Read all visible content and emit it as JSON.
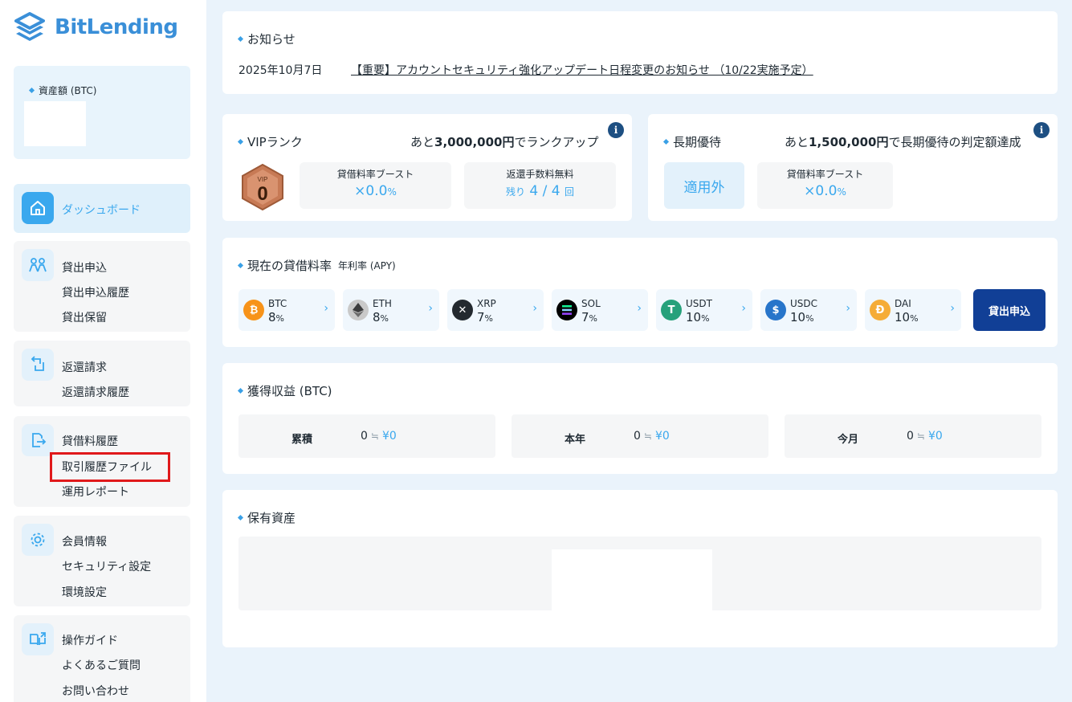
{
  "brand": {
    "name_part1": "Bit",
    "name_part2": "Lending"
  },
  "sidebar": {
    "asset_label": "資産額 (BTC)",
    "groups": [
      {
        "items": [
          "ダッシュボード"
        ]
      },
      {
        "items": [
          "貸出申込",
          "貸出申込履歴",
          "貸出保留"
        ]
      },
      {
        "items": [
          "返還請求",
          "返還請求履歴"
        ]
      },
      {
        "items": [
          "貸借料履歴",
          "取引履歴ファイル",
          "運用レポート"
        ]
      },
      {
        "items": [
          "会員情報",
          "セキュリティ設定",
          "環境設定"
        ]
      },
      {
        "items": [
          "操作ガイド",
          "よくあるご質問",
          "お問い合わせ"
        ]
      }
    ]
  },
  "news": {
    "title": "お知らせ",
    "date": "2025年10月7日",
    "headline": "【重要】アカウントセキュリティ強化アップデート日程変更のお知らせ （10/22実施予定）"
  },
  "vip": {
    "title": "VIPランク",
    "prefix": "あと",
    "amount": "3,000,000円",
    "suffix": "でランクアップ",
    "badge_label": "VIP",
    "badge_level": "0",
    "boost_label": "貸借料率ブースト",
    "boost_prefix": "×",
    "boost_value": "0.0",
    "boost_unit": "%",
    "fee_label": "返還手数料無料",
    "fee_prefix": "残り",
    "fee_value": "4 / 4",
    "fee_unit": "回",
    "info": "i"
  },
  "longterm": {
    "title": "長期優待",
    "prefix": "あと",
    "amount": "1,500,000円",
    "suffix": "で長期優待の判定額達成",
    "status": "適用外",
    "boost_label": "貸借料率ブースト",
    "boost_prefix": "×",
    "boost_value": "0.0",
    "boost_unit": "%",
    "info": "i"
  },
  "rates": {
    "title": "現在の貸借料率",
    "subtitle": "年利率 (APY)",
    "unit": "%",
    "coins": [
      {
        "name": "BTC",
        "rate": "8",
        "color": "#f7931a",
        "icon": "bitcoin-icon"
      },
      {
        "name": "ETH",
        "rate": "8",
        "color": "#c9c9c9",
        "icon": "ethereum-icon"
      },
      {
        "name": "XRP",
        "rate": "7",
        "color": "#23292f",
        "icon": "xrp-icon"
      },
      {
        "name": "SOL",
        "rate": "7",
        "color": "#000000",
        "icon": "solana-icon"
      },
      {
        "name": "USDT",
        "rate": "10",
        "color": "#26a17b",
        "icon": "tether-icon"
      },
      {
        "name": "USDC",
        "rate": "10",
        "color": "#2775ca",
        "icon": "usdc-icon"
      },
      {
        "name": "DAI",
        "rate": "10",
        "color": "#f5ac37",
        "icon": "dai-icon"
      }
    ],
    "apply_label": "貸出申込"
  },
  "earnings": {
    "title": "獲得収益 (BTC)",
    "approx": "≒",
    "rows": [
      {
        "label": "累積",
        "value": "0",
        "yen": "¥0"
      },
      {
        "label": "本年",
        "value": "0",
        "yen": "¥0"
      },
      {
        "label": "今月",
        "value": "0",
        "yen": "¥0"
      }
    ]
  },
  "holdings": {
    "title": "保有資産"
  }
}
